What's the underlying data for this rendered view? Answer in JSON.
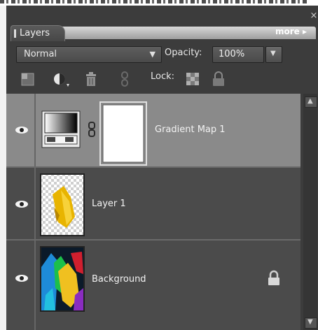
{
  "panel": {
    "tab_label": "Layers",
    "more_label": "more",
    "close_glyph": "×"
  },
  "controls": {
    "blend_mode": "Normal",
    "opacity_label": "Opacity:",
    "opacity_value": "100%",
    "lock_label": "Lock:"
  },
  "toolbar": {
    "icons": [
      "new-layer-icon",
      "adjustment-layer-icon",
      "trash-icon",
      "link-icon",
      "lock-transparency-icon",
      "lock-all-icon"
    ]
  },
  "layers": [
    {
      "name": "Gradient Map 1",
      "selected": true,
      "type": "adjustment"
    },
    {
      "name": "Layer 1",
      "selected": false,
      "type": "pixel"
    },
    {
      "name": "Background",
      "selected": false,
      "type": "background",
      "locked": true
    }
  ],
  "colors": {
    "panel_bg": "#3c3c3c",
    "selected_row": "#8a8a8a",
    "row_bg": "#4b4b4b"
  }
}
